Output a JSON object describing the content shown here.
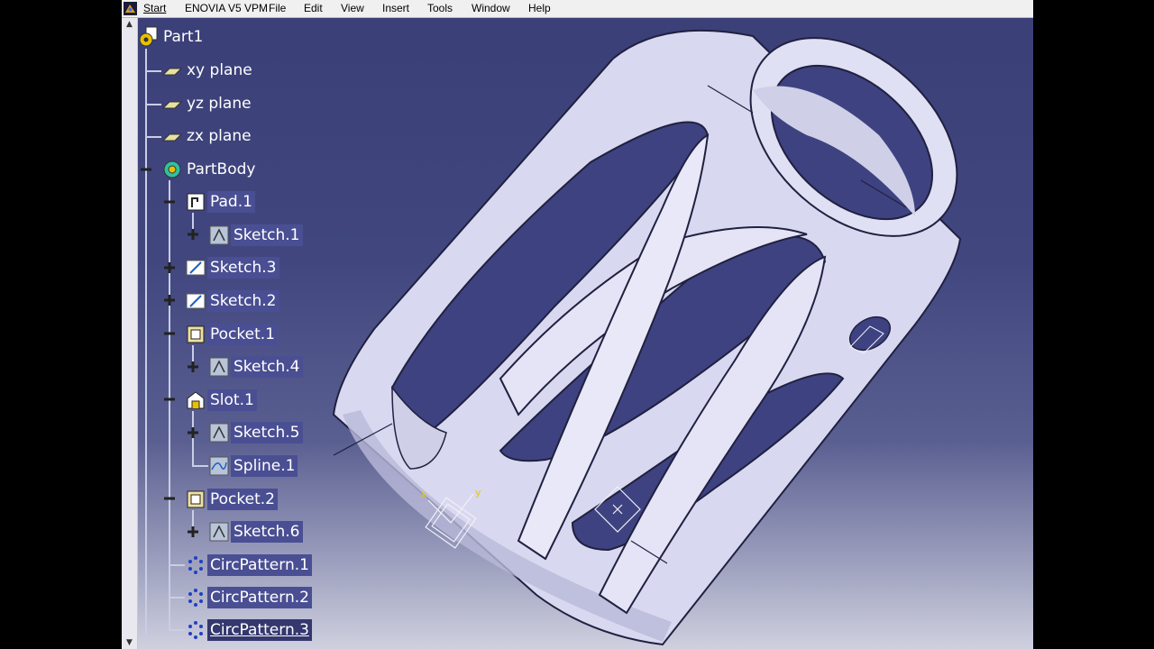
{
  "menubar": {
    "items": [
      "Start",
      "ENOVIA V5 VPM",
      "File",
      "Edit",
      "View",
      "Insert",
      "Tools",
      "Window",
      "Help"
    ]
  },
  "tree": {
    "root": "Part1",
    "planes": [
      "xy plane",
      "yz plane",
      "zx plane"
    ],
    "body": "PartBody",
    "features": [
      {
        "label": "Pad.1",
        "icon": "pad-icon",
        "children": [
          "Sketch.1"
        ]
      },
      {
        "label": "Sketch.3",
        "icon": "sketch-icon",
        "children": []
      },
      {
        "label": "Sketch.2",
        "icon": "sketch-icon",
        "children": []
      },
      {
        "label": "Pocket.1",
        "icon": "pocket-icon",
        "children": [
          "Sketch.4"
        ]
      },
      {
        "label": "Slot.1",
        "icon": "slot-icon",
        "children": [
          "Sketch.5",
          "Spline.1"
        ]
      },
      {
        "label": "Pocket.2",
        "icon": "pocket-icon",
        "children": [
          "Sketch.6"
        ]
      },
      {
        "label": "CircPattern.1",
        "icon": "circ-pattern-icon",
        "children": []
      },
      {
        "label": "CircPattern.2",
        "icon": "circ-pattern-icon",
        "children": []
      },
      {
        "label": "CircPattern.3",
        "icon": "circ-pattern-icon",
        "children": []
      }
    ]
  },
  "viewport": {
    "background_top": "#3b3f77",
    "background_bottom": "#cfd0df",
    "model_color": "#d8d8f0",
    "axis_labels": [
      "x",
      "y"
    ]
  },
  "colors": {
    "tree_text": "#ffffff",
    "selection": "#4a4f93",
    "tree_line": "#c9cde6"
  }
}
